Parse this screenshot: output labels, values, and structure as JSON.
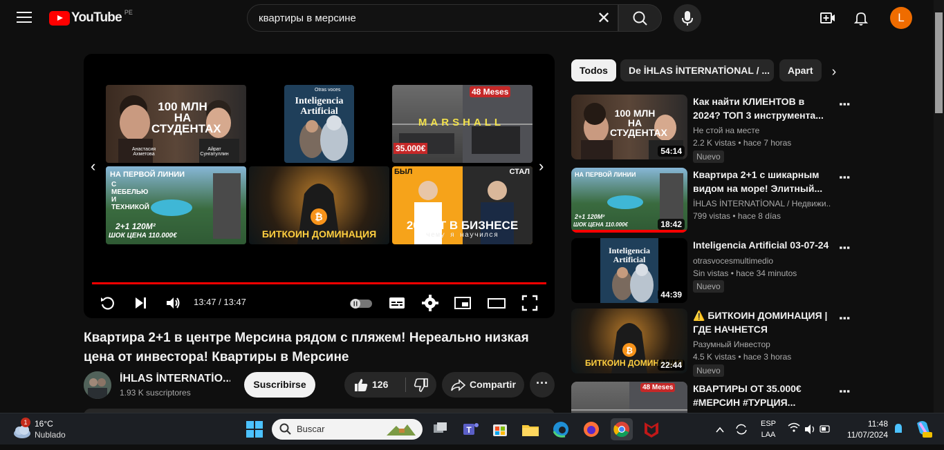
{
  "topbar": {
    "brand": "YouTube",
    "country_code": "PE",
    "search_value": "квартиры в мерсине",
    "avatar_letter": "L"
  },
  "player": {
    "time": "13:47 / 13:47",
    "progress_fraction": 1.0,
    "endscreen": [
      {
        "title_text": "100 МЛН НА СТУДЕНТАХ",
        "caption_left": "Анастасия Ахметова",
        "caption_right": "Айрат Сунгатуллин"
      },
      {
        "title_text": "Inteligencia Artificial",
        "logo": "Otras voces"
      },
      {
        "title_text": "MARSHALL",
        "badge": "48 Meses",
        "price": "35.000€"
      },
      {
        "title_text": "НА ПЕРВОЙ ЛИНИИ",
        "sub": "С МЕБЕЛЬЮ И ТЕХНИКОЙ",
        "spec": "2+1 120M²",
        "price": "ШОК ЦЕНА 110.000€"
      },
      {
        "title_text": "БИТКОИН ДОМИНАЦИЯ"
      },
      {
        "left_label": "БЫЛ",
        "right_label": "СТАЛ",
        "title_text": "20 ЛЕТ В БИЗНЕСЕ",
        "sub": "чему я научился"
      }
    ]
  },
  "video": {
    "title": "Квартира 2+1 в центре Мерсина рядом с пляжем! Нереально низкая цена от инвестора! Квартиры в Мерсине",
    "channel": "İHLAS İNTERNATİO...",
    "subscribers": "1.93 K suscriptores",
    "subscribe_label": "Suscribirse",
    "likes": "126",
    "share_label": "Compartir"
  },
  "chips": [
    "Todos",
    "De İHLAS İNTERNATİONAL / ...",
    "Apart"
  ],
  "recommendations": [
    {
      "title": "Как найти КЛИЕНТОВ в 2024? ТОП 3 инструмента...",
      "channel": "Не стой на месте",
      "views": "2.2 K vistas",
      "age": "hace 7 horas",
      "badge": "Nuevo",
      "duration": "54:14"
    },
    {
      "title": "Квартира 2+1 с шикарным видом на море! Элитный...",
      "channel": "İHLAS İNTERNATİONAL / Недвижи...",
      "views": "799 vistas",
      "age": "hace 8 días",
      "badge": "",
      "duration": "18:42"
    },
    {
      "title": "Inteligencia Artificial 03-07-24",
      "channel": "otrasvocesmultimedio",
      "views": "Sin vistas",
      "age": "hace 34 minutos",
      "badge": "Nuevo",
      "duration": "44:39"
    },
    {
      "title": "⚠️ БИТКОИН ДОМИНАЦИЯ | ГДЕ НАЧНЕТСЯ АЛЬТСЕЗОН...",
      "channel": "Разумный Инвестор",
      "views": "4.5 K vistas",
      "age": "hace 3 horas",
      "badge": "Nuevo",
      "duration": "22:44"
    },
    {
      "title": "КВАРТИРЫ ОТ 35.000€ #МЕРСИН #ТУРЦИЯ...",
      "channel": "",
      "views": "",
      "age": "",
      "badge": "",
      "duration": ""
    }
  ],
  "taskbar": {
    "weather_temp": "16°C",
    "weather_desc": "Nublado",
    "weather_badge": "1",
    "search_placeholder": "Buscar",
    "lang_top": "ESP",
    "lang_bottom": "LAA",
    "time": "11:48",
    "date": "11/07/2024"
  }
}
